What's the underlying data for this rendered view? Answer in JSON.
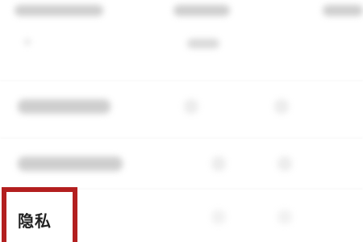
{
  "header": {
    "items": [
      {
        "name": "header-item-1"
      },
      {
        "name": "header-item-2"
      },
      {
        "name": "header-item-3"
      }
    ]
  },
  "privacy": {
    "label": "隐私"
  },
  "colors": {
    "highlight_border": "#b31f1f",
    "text": "#222222",
    "background": "#ffffff"
  }
}
